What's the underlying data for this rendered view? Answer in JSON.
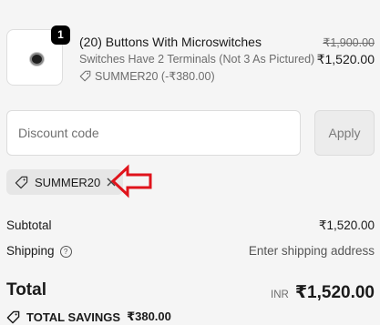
{
  "product": {
    "quantity": "1",
    "name": "(20) Buttons With Microswitches",
    "variant": "Switches Have 2 Terminals (Not 3 As Pictured)",
    "discount_line": "SUMMER20 (-₹380.00)",
    "original_price": "₹1,900.00",
    "price": "₹1,520.00"
  },
  "discount": {
    "placeholder": "Discount code",
    "apply_label": "Apply",
    "applied_code": "SUMMER20"
  },
  "summary": {
    "subtotal_label": "Subtotal",
    "subtotal_value": "₹1,520.00",
    "shipping_label": "Shipping",
    "shipping_help": "?",
    "shipping_value": "Enter shipping address",
    "total_label": "Total",
    "currency": "INR",
    "total_value": "₹1,520.00",
    "savings_label": "TOTAL SAVINGS",
    "savings_value": "₹380.00"
  },
  "colors": {
    "background": "#f5f5f5",
    "annotation_arrow": "#e0131b"
  },
  "icons": [
    "tag-icon",
    "close-icon",
    "help-circle-icon",
    "arrow-left-icon"
  ]
}
